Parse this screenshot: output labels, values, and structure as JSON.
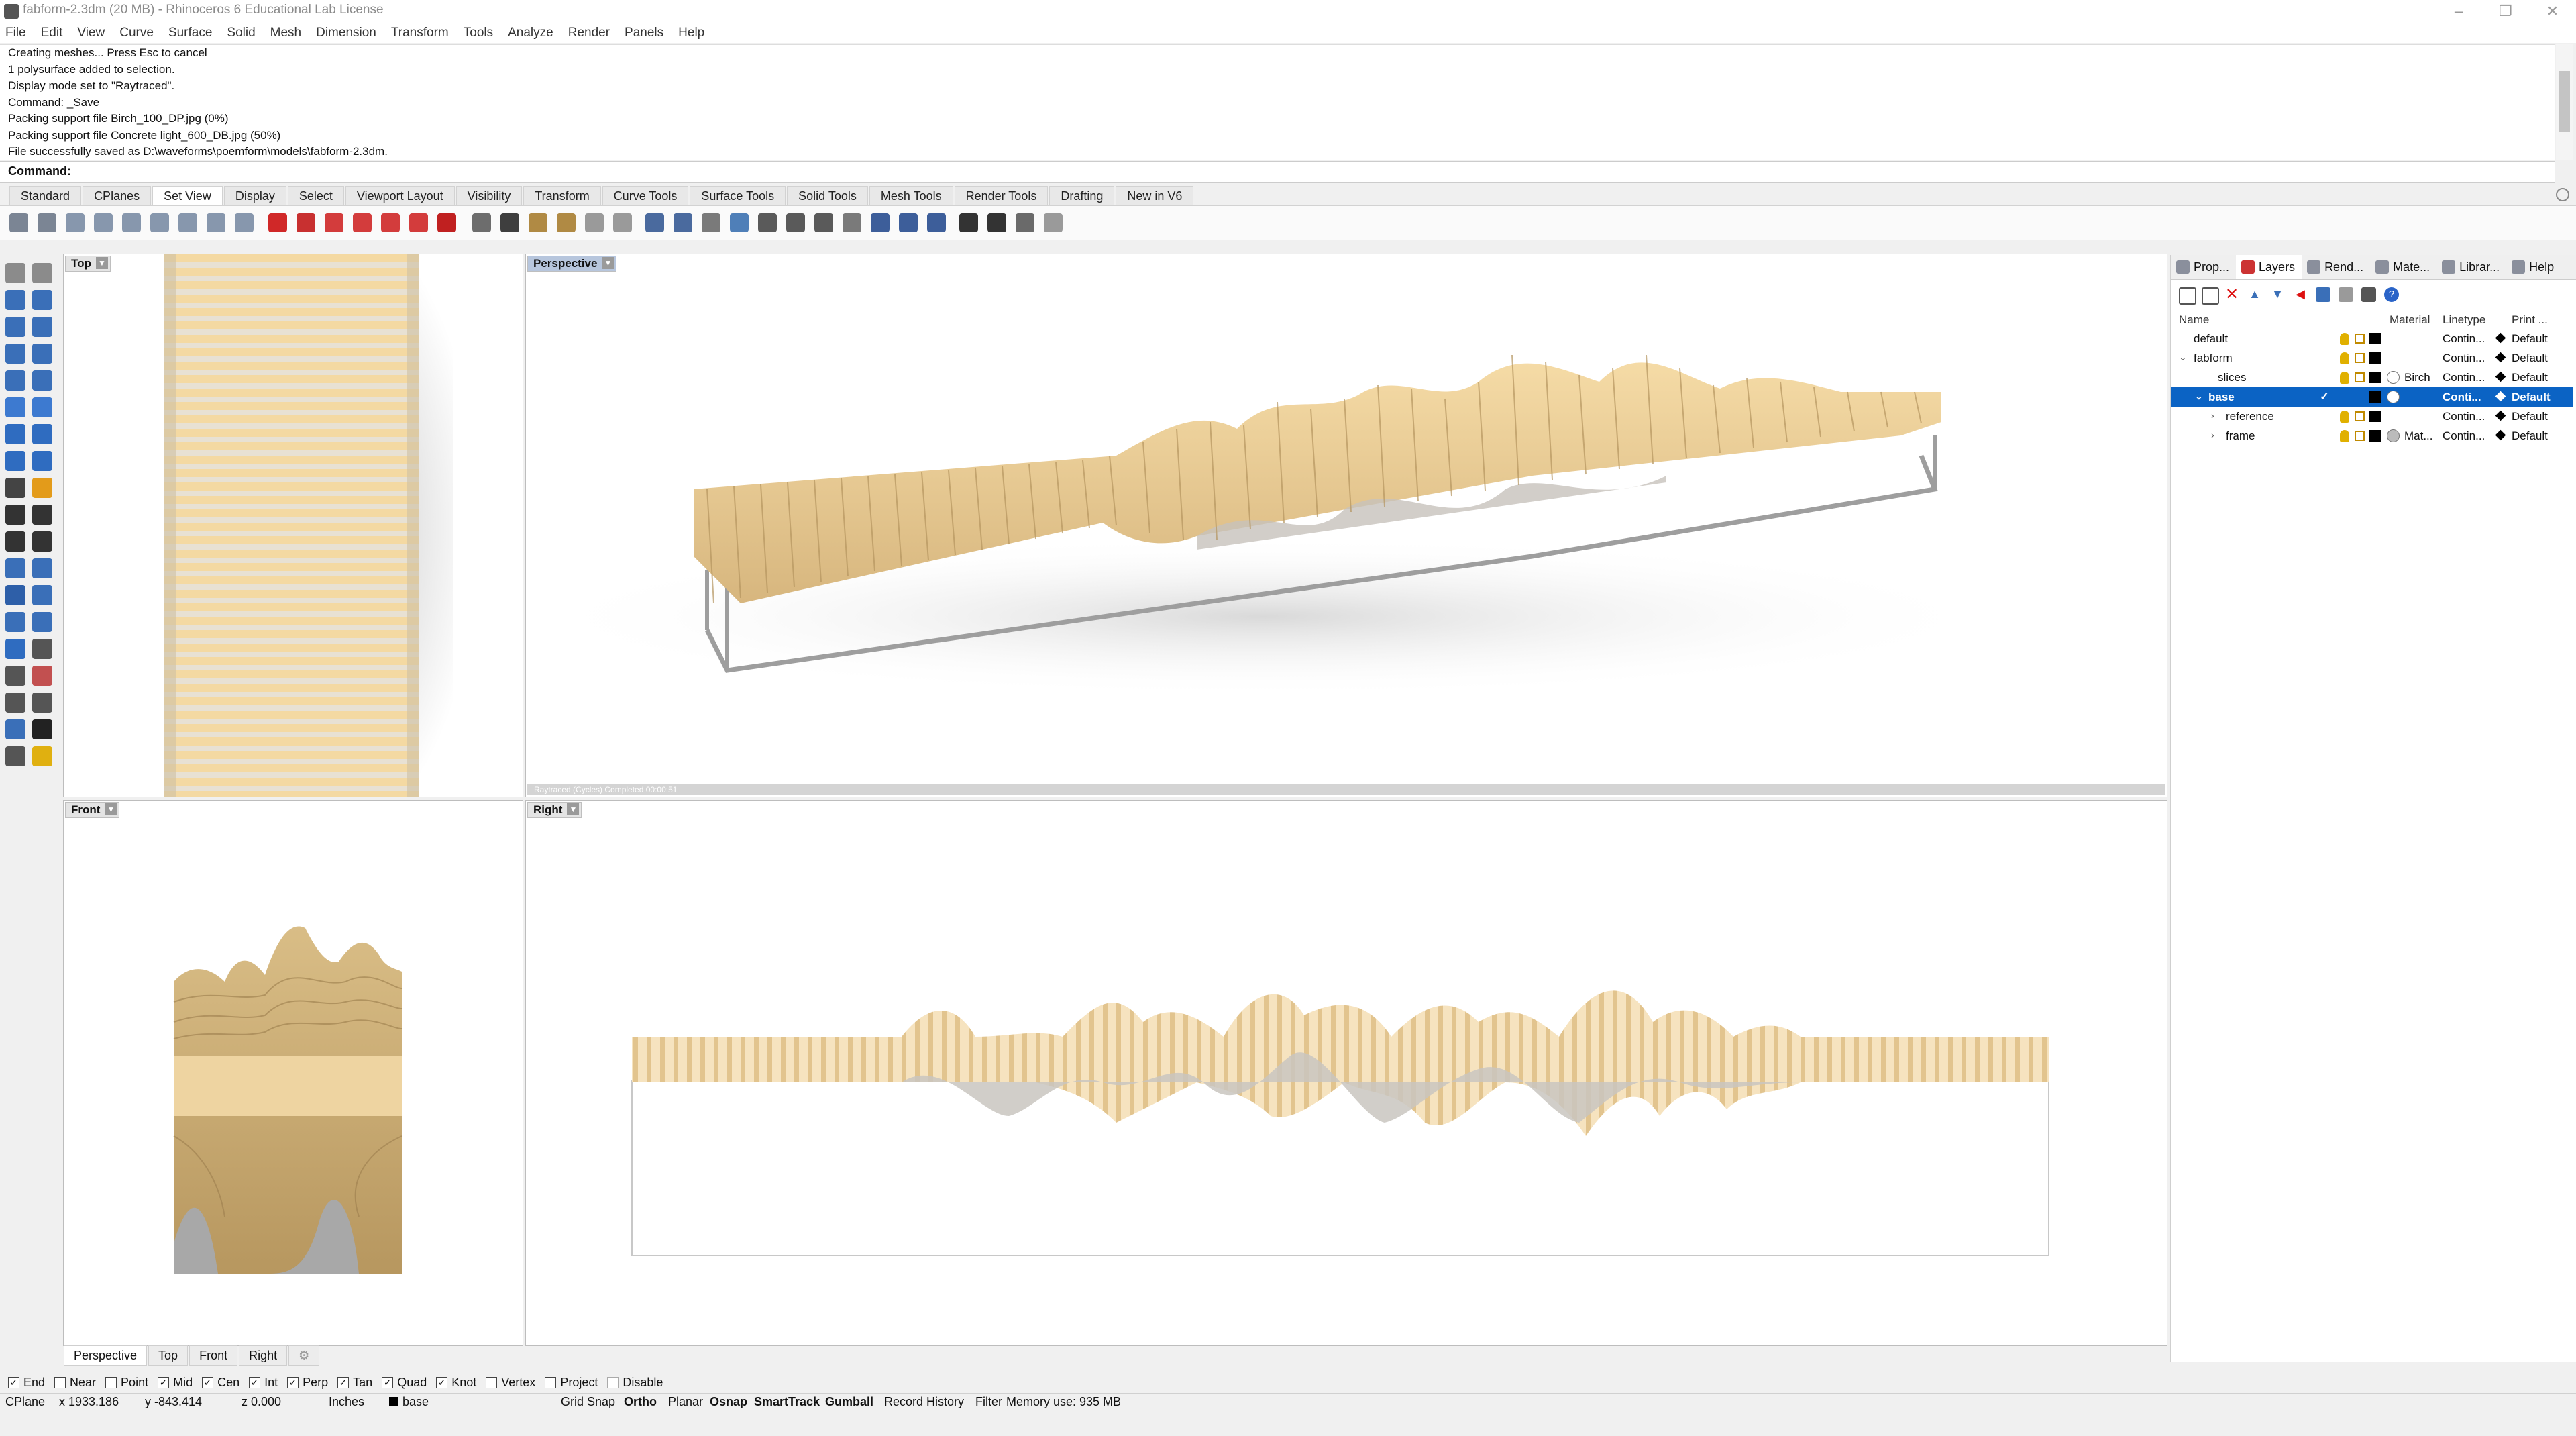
{
  "window": {
    "title": "fabform-2.3dm (20 MB) - Rhinoceros 6 Educational Lab License"
  },
  "menu": [
    "File",
    "Edit",
    "View",
    "Curve",
    "Surface",
    "Solid",
    "Mesh",
    "Dimension",
    "Transform",
    "Tools",
    "Analyze",
    "Render",
    "Panels",
    "Help"
  ],
  "command_history": [
    "Creating meshes... Press Esc to cancel",
    "1 polysurface added to selection.",
    "Display mode set to \"Raytraced\".",
    "Command: _Save",
    "Packing support file Birch_100_DP.jpg (0%)",
    "Packing support file Concrete light_600_DB.jpg (50%)",
    "File successfully saved as D:\\waveforms\\poemform\\models\\fabform-2.3dm."
  ],
  "command_prompt": "Command:",
  "toolbar_tabs": [
    "Standard",
    "CPlanes",
    "Set View",
    "Display",
    "Select",
    "Viewport Layout",
    "Visibility",
    "Transform",
    "Curve Tools",
    "Surface Tools",
    "Solid Tools",
    "Mesh Tools",
    "Render Tools",
    "Drafting",
    "New in V6"
  ],
  "active_toolbar_tab": "Set View",
  "viewports": {
    "top": "Top",
    "perspective": "Perspective",
    "front": "Front",
    "right": "Right",
    "perspective_status": "Raytraced (Cycles)   Completed    00:00:51"
  },
  "viewport_tabs": [
    "Perspective",
    "Top",
    "Front",
    "Right"
  ],
  "panel_tabs": [
    "Prop...",
    "Layers",
    "Rend...",
    "Mate...",
    "Librar...",
    "Help"
  ],
  "active_panel_tab": "Layers",
  "layers": {
    "headers": {
      "name": "Name",
      "material": "Material",
      "linetype": "Linetype",
      "print": "Print ..."
    },
    "rows": [
      {
        "name": "default",
        "material": "",
        "linetype": "Contin...",
        "print": "Default"
      },
      {
        "name": "fabform",
        "material": "",
        "linetype": "Contin...",
        "print": "Default"
      },
      {
        "name": "slices",
        "material": "Birch",
        "linetype": "Contin...",
        "print": "Default"
      },
      {
        "name": "base",
        "material": "",
        "linetype": "Conti...",
        "print": "Default"
      },
      {
        "name": "reference",
        "material": "",
        "linetype": "Contin...",
        "print": "Default"
      },
      {
        "name": "frame",
        "material": "Mat...",
        "linetype": "Contin...",
        "print": "Default"
      }
    ]
  },
  "osnaps": [
    {
      "label": "End",
      "checked": true
    },
    {
      "label": "Near",
      "checked": false
    },
    {
      "label": "Point",
      "checked": false
    },
    {
      "label": "Mid",
      "checked": true
    },
    {
      "label": "Cen",
      "checked": true
    },
    {
      "label": "Int",
      "checked": true
    },
    {
      "label": "Perp",
      "checked": true
    },
    {
      "label": "Tan",
      "checked": true
    },
    {
      "label": "Quad",
      "checked": true
    },
    {
      "label": "Knot",
      "checked": true
    },
    {
      "label": "Vertex",
      "checked": false
    },
    {
      "label": "Project",
      "checked": false
    },
    {
      "label": "Disable",
      "checked": false
    }
  ],
  "status": {
    "cplane": "CPlane",
    "x": "x 1933.186",
    "y": "y -843.414",
    "z": "z 0.000",
    "units": "Inches",
    "layer": "base",
    "grid_snap": "Grid Snap",
    "ortho": "Ortho",
    "planar": "Planar",
    "osnap": "Osnap",
    "smarttrack": "SmartTrack",
    "gumball": "Gumball",
    "record_history": "Record History",
    "filter": "Filter",
    "memory": "Memory use: 935 MB"
  },
  "colors": {
    "wood": "#e9cf9b",
    "wood_dark": "#b79a6a",
    "selection": "#0b63c4",
    "viewport_active_title": "#b7c6dd"
  }
}
